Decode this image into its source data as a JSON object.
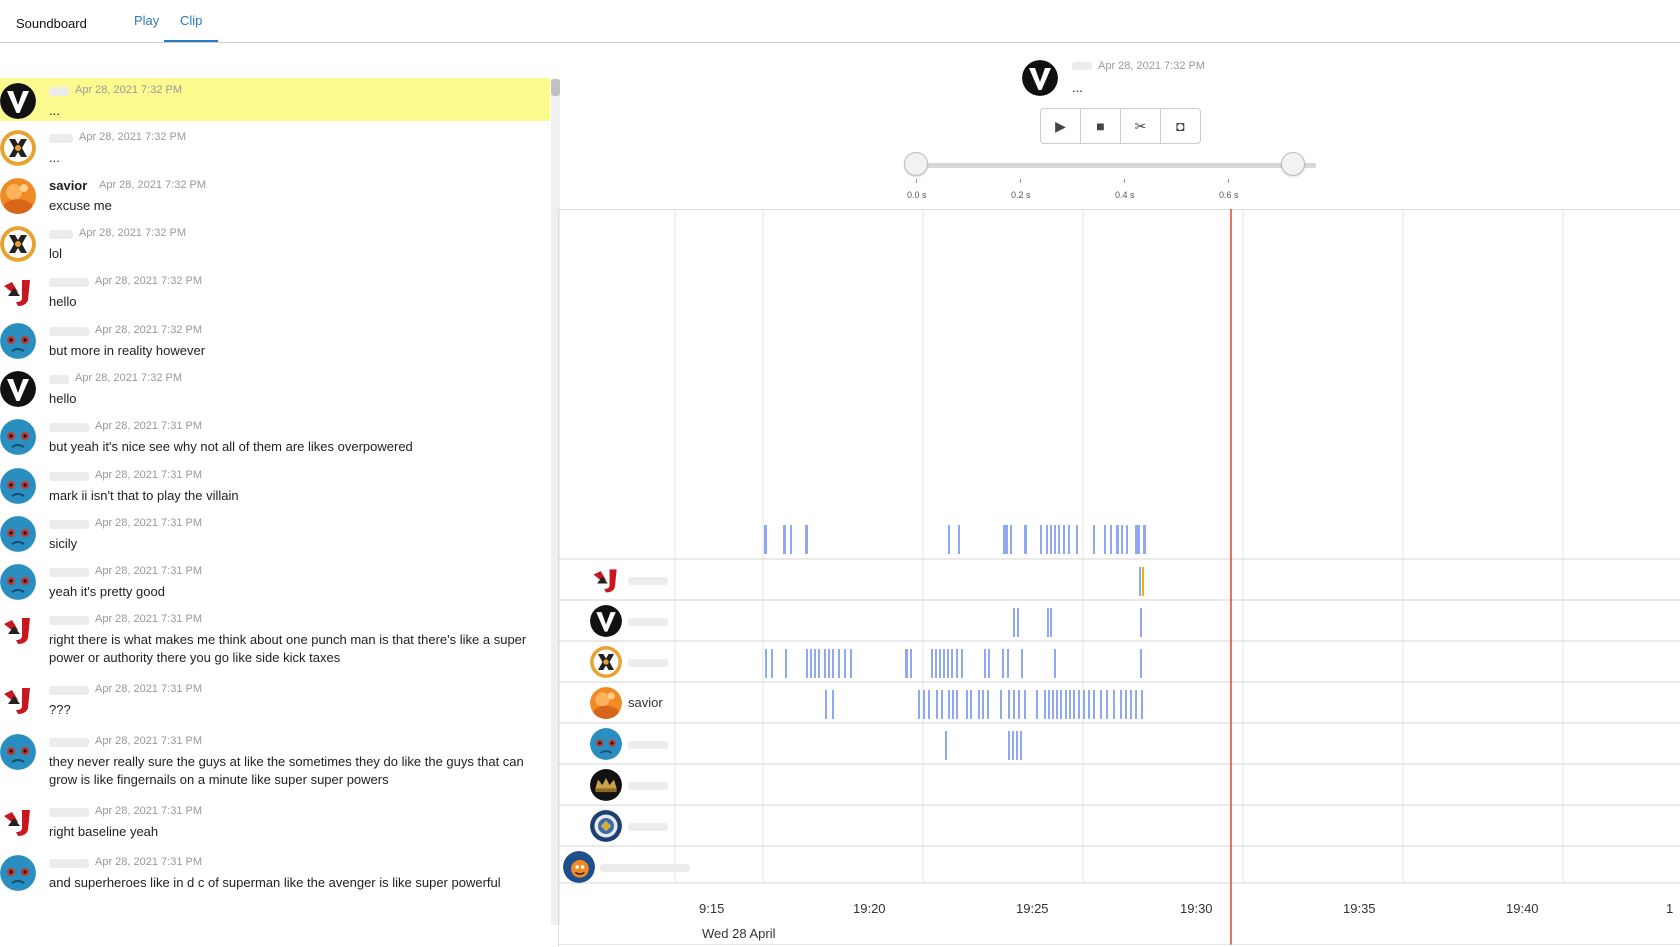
{
  "nav": {
    "brand": "Soundboard",
    "tabs": [
      {
        "label": "Play",
        "active": false
      },
      {
        "label": "Clip",
        "active": true
      }
    ],
    "accent_color": "#2a7abf"
  },
  "chat": {
    "highlight_color": "#fbfb8f",
    "messages": [
      {
        "name": "",
        "avatar": "v-logo",
        "time": "Apr 28, 2021 7:32 PM",
        "text": "...",
        "highlighted": true
      },
      {
        "name": "",
        "avatar": "x-logo",
        "time": "Apr 28, 2021 7:32 PM",
        "text": "..."
      },
      {
        "name": "savior",
        "avatar": "orange-avatar",
        "time": "Apr 28, 2021 7:32 PM",
        "text": "excuse me"
      },
      {
        "name": "",
        "avatar": "x-logo",
        "time": "Apr 28, 2021 7:32 PM",
        "text": "lol"
      },
      {
        "name": "",
        "avatar": "mj-logo",
        "time": "Apr 28, 2021 7:32 PM",
        "text": "hello"
      },
      {
        "name": "",
        "avatar": "blue-face",
        "time": "Apr 28, 2021 7:32 PM",
        "text": "but more in reality however"
      },
      {
        "name": "",
        "avatar": "v-logo",
        "time": "Apr 28, 2021 7:32 PM",
        "text": "hello"
      },
      {
        "name": "",
        "avatar": "blue-face",
        "time": "Apr 28, 2021 7:31 PM",
        "text": "but yeah it's nice see why not all of them are likes overpowered"
      },
      {
        "name": "",
        "avatar": "blue-face",
        "time": "Apr 28, 2021 7:31 PM",
        "text": "mark ii isn't that to play the villain"
      },
      {
        "name": "",
        "avatar": "blue-face",
        "time": "Apr 28, 2021 7:31 PM",
        "text": "sicily"
      },
      {
        "name": "",
        "avatar": "blue-face",
        "time": "Apr 28, 2021 7:31 PM",
        "text": "yeah it's pretty good"
      },
      {
        "name": "",
        "avatar": "mj-logo",
        "time": "Apr 28, 2021 7:31 PM",
        "text": "right there is what makes me think about one punch man is that there's like a super power or authority there you go like side kick taxes"
      },
      {
        "name": "",
        "avatar": "mj-logo",
        "time": "Apr 28, 2021 7:31 PM",
        "text": "???"
      },
      {
        "name": "",
        "avatar": "blue-face",
        "time": "Apr 28, 2021 7:31 PM",
        "text": "they never really sure the guys at like the sometimes they do like the guys that can grow is like fingernails on a minute like super super powers"
      },
      {
        "name": "",
        "avatar": "mj-logo",
        "time": "Apr 28, 2021 7:31 PM",
        "text": "right baseline yeah"
      },
      {
        "name": "",
        "avatar": "blue-face",
        "time": "Apr 28, 2021 7:31 PM",
        "text": "and superheroes like in d c of superman like the avenger is like super powerful"
      }
    ]
  },
  "player": {
    "avatar": "v-logo",
    "name": "",
    "time": "Apr 28, 2021 7:32 PM",
    "text": "...",
    "controls": [
      {
        "name": "play-icon",
        "glyph": "▶"
      },
      {
        "name": "stop-icon",
        "glyph": "■"
      },
      {
        "name": "scissors-icon",
        "glyph": "✂"
      },
      {
        "name": "discord-icon",
        "glyph": "◘"
      }
    ],
    "slider": {
      "range_start_s": 0.0,
      "range_end_s": 0.75,
      "ticks": [
        "0.0 s",
        "0.2 s",
        "0.4 s",
        "0.6 s"
      ]
    }
  },
  "timeline": {
    "x_ticks": [
      "9:15",
      "19:20",
      "19:25",
      "19:30",
      "19:35",
      "19:40",
      "1"
    ],
    "date_label": "Wed 28 April",
    "cursor_time": "19:31:45",
    "cursor_color": "#e5432f",
    "bar_color": "#8fa8ef",
    "highlight_bar_color": "#f0b400",
    "rows": [
      {
        "name": "",
        "avatar": "mj-logo"
      },
      {
        "name": "",
        "avatar": "v-logo"
      },
      {
        "name": "",
        "avatar": "x-logo"
      },
      {
        "name": "savior",
        "avatar": "orange-avatar"
      },
      {
        "name": "",
        "avatar": "blue-face"
      },
      {
        "name": "",
        "avatar": "crown-avatar"
      },
      {
        "name": "",
        "avatar": "seal-avatar"
      },
      {
        "name": "",
        "avatar": "cartoon-avatar"
      }
    ]
  }
}
